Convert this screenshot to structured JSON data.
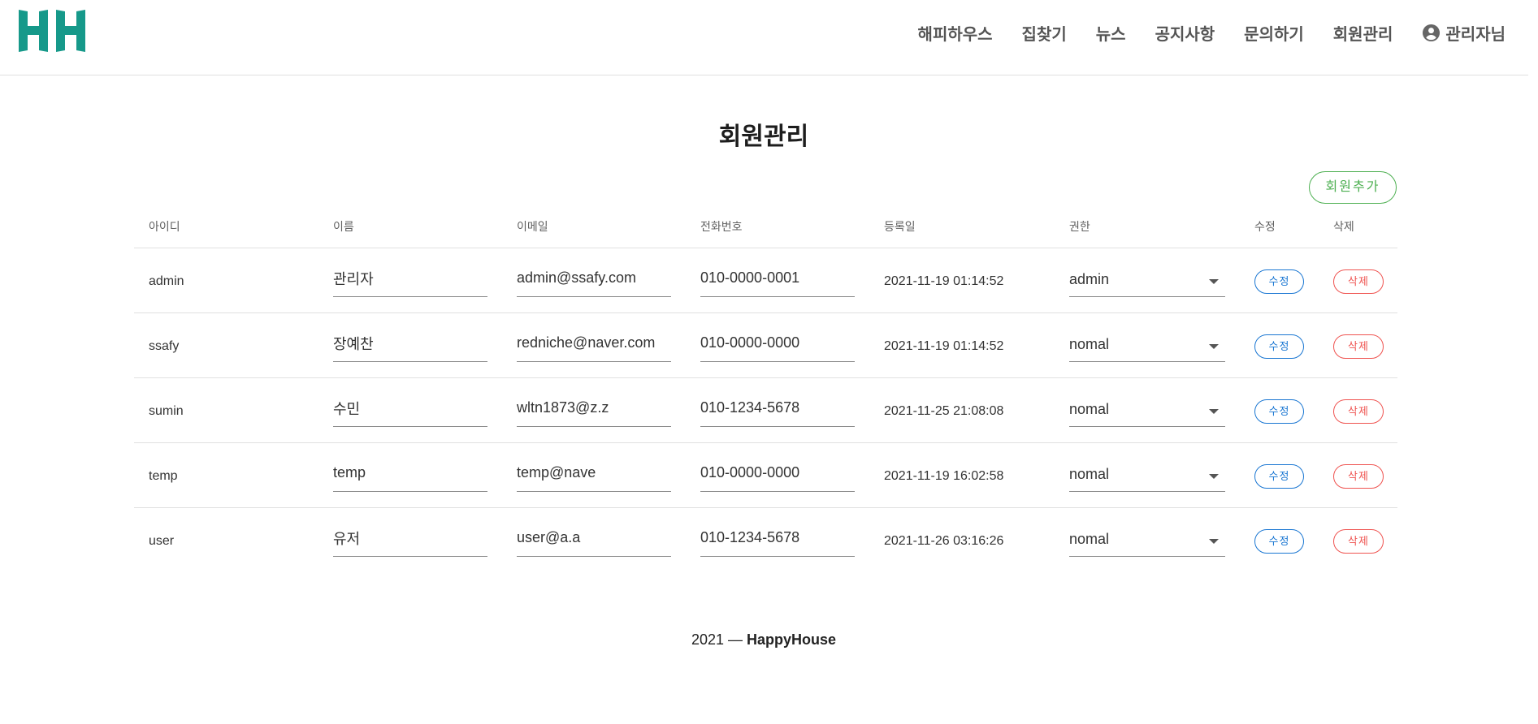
{
  "header": {
    "logo_text": "HH",
    "brand_color": "#16998a",
    "nav": [
      {
        "label": "해피하우스"
      },
      {
        "label": "집찾기"
      },
      {
        "label": "뉴스"
      },
      {
        "label": "공지사항"
      },
      {
        "label": "문의하기"
      },
      {
        "label": "회원관리"
      },
      {
        "label": "관리자님",
        "icon": "account-circle-icon"
      }
    ]
  },
  "page": {
    "title": "회원관리",
    "add_button": "회원추가"
  },
  "table": {
    "columns": [
      "아이디",
      "이름",
      "이메일",
      "전화번호",
      "등록일",
      "권한",
      "수정",
      "삭제"
    ],
    "edit_label": "수정",
    "delete_label": "삭제",
    "rows": [
      {
        "id": "admin",
        "name": "관리자",
        "email": "admin@ssafy.com",
        "phone": "010-0000-0001",
        "registered": "2021-11-19 01:14:52",
        "role": "admin"
      },
      {
        "id": "ssafy",
        "name": "장예찬",
        "email": "redniche@naver.com",
        "phone": "010-0000-0000",
        "registered": "2021-11-19 01:14:52",
        "role": "nomal"
      },
      {
        "id": "sumin",
        "name": "수민",
        "email": "wltn1873@z.z",
        "phone": "010-1234-5678",
        "registered": "2021-11-25 21:08:08",
        "role": "nomal"
      },
      {
        "id": "temp",
        "name": "temp",
        "email": "temp@nave",
        "phone": "010-0000-0000",
        "registered": "2021-11-19 16:02:58",
        "role": "nomal"
      },
      {
        "id": "user",
        "name": "유저",
        "email": "user@a.a",
        "phone": "010-1234-5678",
        "registered": "2021-11-26 03:16:26",
        "role": "nomal"
      }
    ]
  },
  "footer": {
    "year": "2021 —",
    "brand": "HappyHouse"
  },
  "colors": {
    "add_button": "#4caf50",
    "edit_button": "#1976d2",
    "delete_button": "#ef5350"
  }
}
